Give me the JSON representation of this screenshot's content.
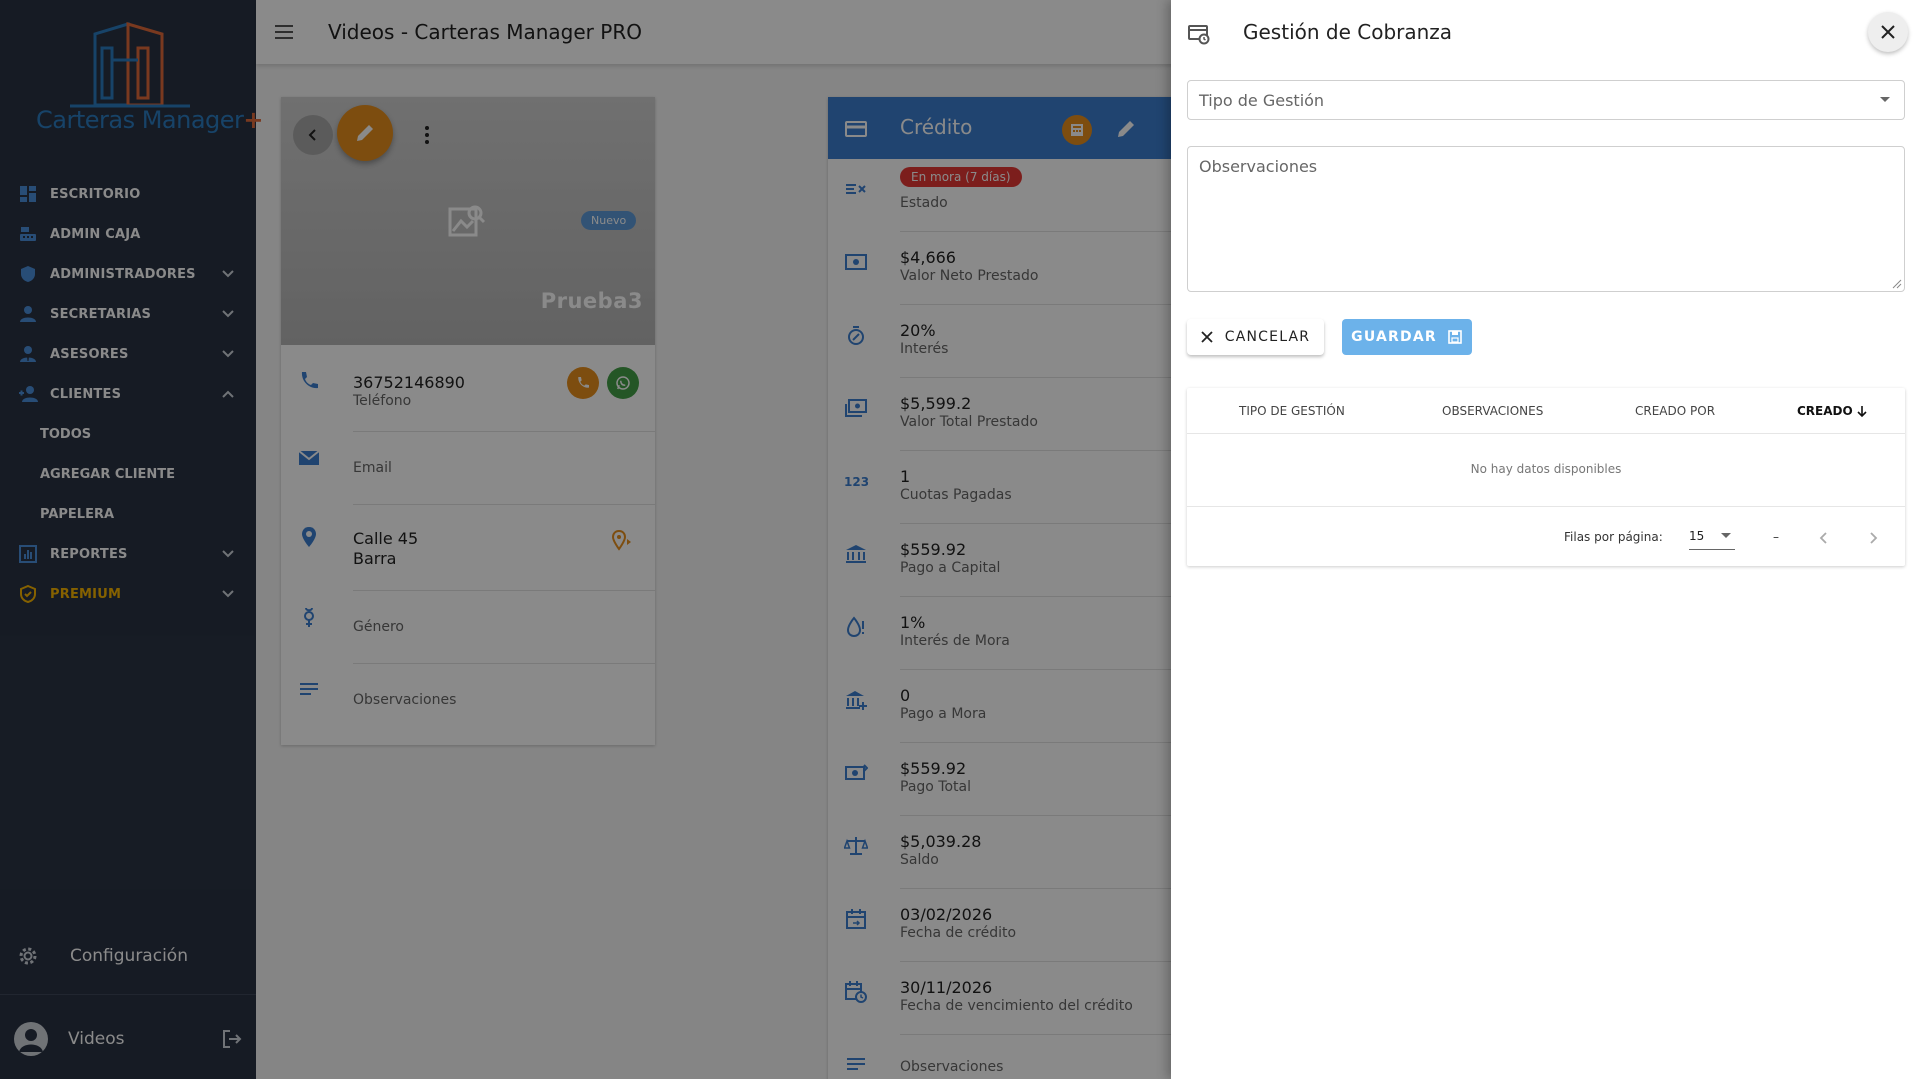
{
  "sidebar": {
    "logo": {
      "text": "Carteras Manager",
      "plus": "+"
    },
    "items": [
      {
        "label": "ESCRITORIO",
        "icon": "dashboard-icon"
      },
      {
        "label": "ADMIN CAJA",
        "icon": "cash-register-icon"
      },
      {
        "label": "ADMINISTRADORES",
        "icon": "shield-icon"
      },
      {
        "label": "SECRETARIAS",
        "icon": "user-icon"
      },
      {
        "label": "ASESORES",
        "icon": "user-tie-icon"
      },
      {
        "label": "CLIENTES",
        "icon": "users-icon"
      },
      {
        "label": "TODOS"
      },
      {
        "label": "AGREGAR CLIENTE"
      },
      {
        "label": "PAPELERA"
      },
      {
        "label": "REPORTES",
        "icon": "chart-icon"
      },
      {
        "label": "PREMIUM",
        "icon": "premium-shield-icon"
      }
    ],
    "config_label": "Configuración",
    "user_name": "Videos"
  },
  "topbar": {
    "title": "Videos - Carteras Manager PRO"
  },
  "client": {
    "badge": "Nuevo",
    "name": "Prueba3",
    "phone": "36752146890",
    "phone_label": "Teléfono",
    "email_label": "Email",
    "address_line1": "Calle 45",
    "address_line2": "Barra",
    "gender_label": "Género",
    "notes_label": "Observaciones"
  },
  "credit": {
    "title": "Crédito",
    "status_chip": "En mora (7 días)",
    "rows": [
      {
        "label": "Estado"
      },
      {
        "value": "$4,666",
        "label": "Valor Neto Prestado"
      },
      {
        "value": "20%",
        "label": "Interés"
      },
      {
        "value": "$5,599.2",
        "label": "Valor Total Prestado"
      },
      {
        "value": "1",
        "label": "Cuotas Pagadas"
      },
      {
        "value": "$559.92",
        "label": "Pago a Capital"
      },
      {
        "value": "1%",
        "label": "Interés de Mora"
      },
      {
        "value": "0",
        "label": "Pago a Mora"
      },
      {
        "value": "$559.92",
        "label": "Pago Total"
      },
      {
        "value": "$5,039.28",
        "label": "Saldo"
      },
      {
        "value": "03/02/2026",
        "label": "Fecha de crédito"
      },
      {
        "value": "30/11/2026",
        "label": "Fecha de vencimiento del crédito"
      }
    ]
  },
  "drawer": {
    "title": "Gestión de Cobranza",
    "tipo_placeholder": "Tipo de Gestión",
    "obs_placeholder": "Observaciones",
    "cancel_label": "CANCELAR",
    "save_label": "GUARDAR",
    "table": {
      "headers": [
        "TIPO DE GESTIÓN",
        "OBSERVACIONES",
        "CREADO POR",
        "CREADO"
      ],
      "empty_text": "No hay datos disponibles",
      "rows_per_page_label": "Filas por página:",
      "rows_per_page_value": "15",
      "range": "–"
    }
  },
  "colors": {
    "sidebar_bg": "#2a3344",
    "primary": "#3b7fd0",
    "accent": "#e88f1d",
    "danger": "#e53935",
    "premium": "#f5b301"
  }
}
